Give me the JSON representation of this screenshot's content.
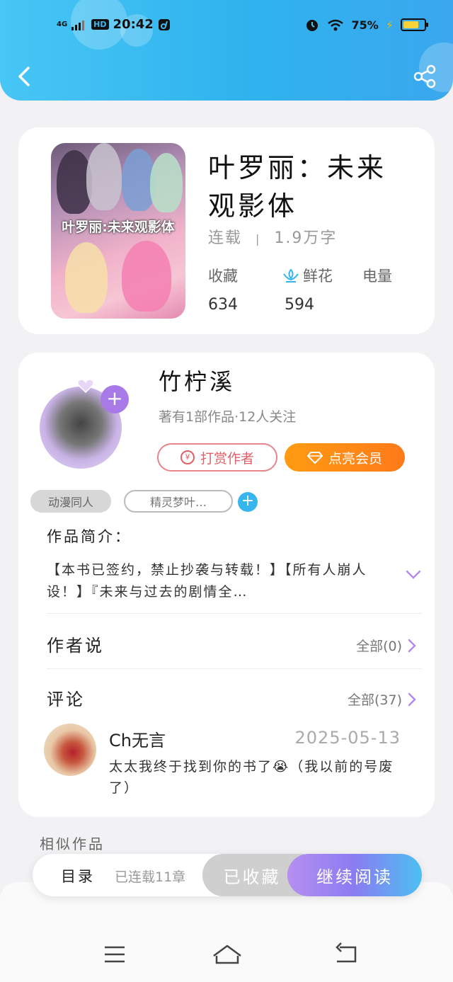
{
  "status_bar": {
    "network": "4G",
    "hd_badge": "HD",
    "time": "20:42",
    "battery_percent": "75%",
    "battery_level": 0.75
  },
  "book": {
    "cover_title": "叶罗丽:未来观影体",
    "title_line1": "叶罗丽：未来",
    "title_line2": "观影体",
    "status": "连载",
    "separator": "|",
    "word_count": "1.9万字",
    "stats": {
      "favorites_label": "收藏",
      "flowers_label": "鲜花",
      "power_label": "电量",
      "favorites_value": "634",
      "flowers_value": "594"
    }
  },
  "author": {
    "name": "竹柠溪",
    "meta": "著有1部作品·12人关注",
    "tip_button": "打赏作者",
    "tip_icon_text": "¥",
    "vip_button": "点亮会员",
    "tags": [
      "动漫同人",
      "精灵梦叶…"
    ]
  },
  "intro": {
    "label": "作品简介：",
    "text": "【本书已签约，禁止抄袭与转载！】【所有人崩人设！】『未来与过去的剧情全…"
  },
  "author_says": {
    "label": "作者说",
    "all": "全部(0)"
  },
  "comments": {
    "label": "评论",
    "all": "全部(37)",
    "items": [
      {
        "user": "Ch无言",
        "date": "2025-05-13",
        "text": "太太我终于找到你的书了😭（我以前的号废了）"
      }
    ]
  },
  "similar_label": "相似作品",
  "bottom_bar": {
    "toc": "目录",
    "chapters": "已连载11章",
    "collected": "已收藏",
    "continue": "继续阅读"
  },
  "colors": {
    "header": "#3ab4ef",
    "vip_orange": "#ff8c16",
    "tip_red": "#e06068",
    "accent_purple": "#a77ae8",
    "accent_blue": "#37b6ee"
  }
}
